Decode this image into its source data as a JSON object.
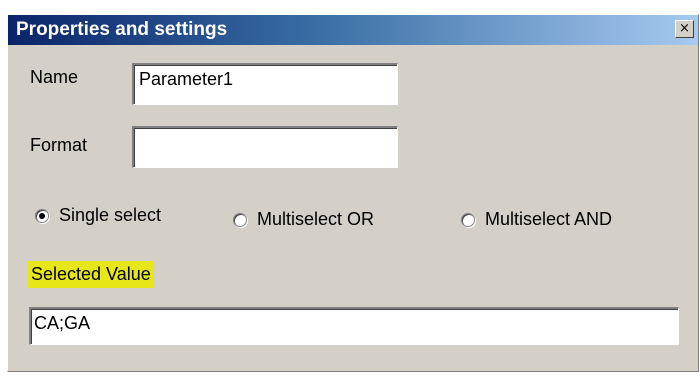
{
  "window": {
    "title": "Properties and settings",
    "close_glyph": "×"
  },
  "fields": {
    "name": {
      "label": "Name",
      "value": "Parameter1"
    },
    "format": {
      "label": "Format",
      "value": ""
    }
  },
  "selection_mode": {
    "selected": "single",
    "options": [
      {
        "id": "single",
        "label": "Single select"
      },
      {
        "id": "multi_or",
        "label": "Multiselect OR"
      },
      {
        "id": "multi_and",
        "label": "Multiselect AND"
      }
    ]
  },
  "selected_value": {
    "label": "Selected Value",
    "value": "CA;GA",
    "highlight_color": "#e6e619"
  }
}
